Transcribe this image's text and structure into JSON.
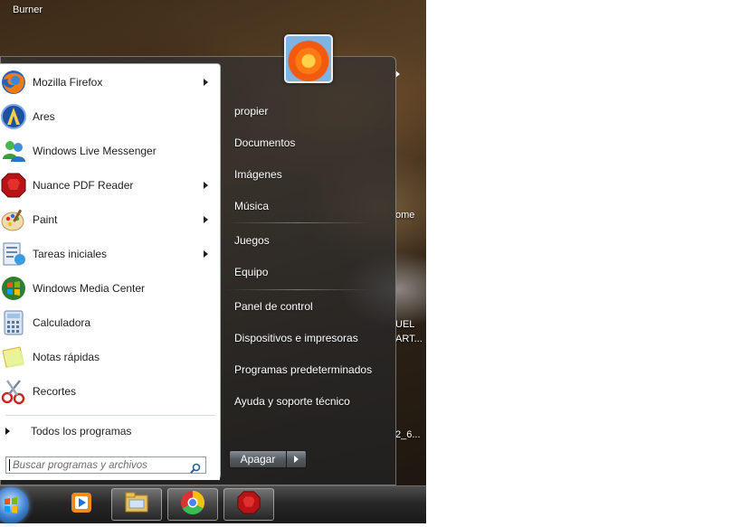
{
  "desktop": {
    "labels": [
      "Burner",
      "ome",
      "UEL",
      "ART...",
      "2_6..."
    ]
  },
  "start_menu": {
    "programs": [
      {
        "label": "Mozilla Firefox",
        "icon": "firefox-icon",
        "submenu": true
      },
      {
        "label": "Ares",
        "icon": "ares-icon",
        "submenu": false
      },
      {
        "label": "Windows Live Messenger",
        "icon": "messenger-icon",
        "submenu": false
      },
      {
        "label": "Nuance PDF Reader",
        "icon": "nuance-pdf-icon",
        "submenu": true
      },
      {
        "label": "Paint",
        "icon": "paint-icon",
        "submenu": true
      },
      {
        "label": "Tareas iniciales",
        "icon": "getting-started-icon",
        "submenu": true
      },
      {
        "label": "Windows Media Center",
        "icon": "media-center-icon",
        "submenu": false
      },
      {
        "label": "Calculadora",
        "icon": "calculator-icon",
        "submenu": false
      },
      {
        "label": "Notas rápidas",
        "icon": "sticky-notes-icon",
        "submenu": false
      },
      {
        "label": "Recortes",
        "icon": "snipping-tool-icon",
        "submenu": false
      }
    ],
    "all_programs": "Todos los programas",
    "search_placeholder": "Buscar programas y archivos",
    "right_items": [
      "propier",
      "Documentos",
      "Imágenes",
      "Música",
      "Juegos",
      "Equipo",
      "Panel de control",
      "Dispositivos e impresoras",
      "Programas predeterminados",
      "Ayuda y soporte técnico"
    ],
    "shutdown_label": "Apagar"
  },
  "taskbar": {
    "items": [
      "start-orb",
      "media-player-icon",
      "file-explorer-icon",
      "chrome-icon",
      "nuance-pdf-icon"
    ]
  },
  "colors": {
    "menu_text_dark": "#1e1e1e",
    "menu_text_light": "#ffffff"
  }
}
